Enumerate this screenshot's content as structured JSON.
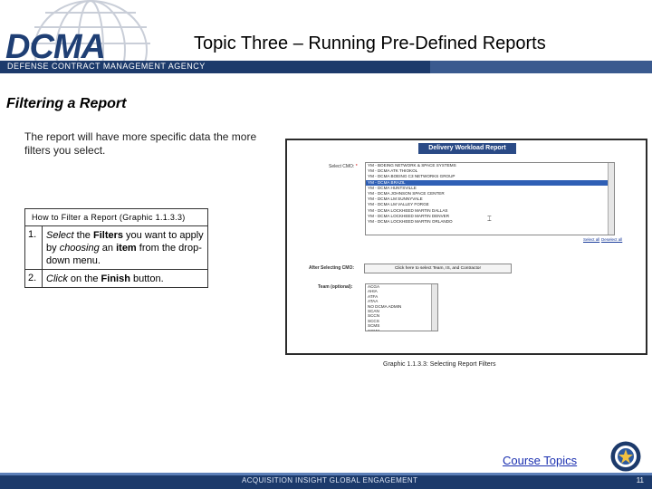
{
  "header": {
    "logo_text": "DCMA",
    "agency_name": "DEFENSE CONTRACT MANAGEMENT AGENCY",
    "title": "Topic Three – Running Pre-Defined Reports"
  },
  "section_title": "Filtering a Report",
  "intro": "The report will have more specific data the more filters you select.",
  "instructions": {
    "header": "How to Filter a Report (Graphic 1.1.3.3)",
    "steps": [
      {
        "num": "1.",
        "text": "Select the Filters you want to apply by choosing an item from the drop-down menu."
      },
      {
        "num": "2.",
        "text": "Click on the Finish button."
      }
    ]
  },
  "screenshot": {
    "title": "Delivery Workload Report",
    "select_cmo_label": "Select CMO:",
    "required_marker": "*",
    "cmo_options": [
      "YM - BOEING NETWORK & SPACE SYSTEMS",
      "YM - DCMA ATK THIOKOL",
      "YM - DCMA BOEING C3 NETWORKS GROUP",
      "YM - DCMA BRAZIL",
      "YM - DCMA HUNTSVILLE",
      "YM - DCMA JOHNSON SPACE CENTER",
      "YM - DCMA LM SUNNYVALE",
      "YM - DCMA LM VALLEY FORGE",
      "YM - DCMA LOCKHEED MARTIN DALLAS",
      "YM - DCMA LOCKHEED MARTIN DENVER",
      "YM - DCMA LOCKHEED MARTIN ORLANDO"
    ],
    "selected_index": 3,
    "select_all_link": "Select all",
    "deselect_all_link": "Deselect all",
    "after_selecting_label": "After Selecting CMO:",
    "team_button_label": "Click here to select Team, IS, and Contractor",
    "team_label": "Team (optional):",
    "team_options": [
      "ACGA",
      "AHIA",
      "ATFA",
      "ATAA",
      "NO DCMA ADMIN",
      "SCAN",
      "SCCN",
      "SCCS",
      "SCMS",
      "SCMX",
      "SCPS"
    ]
  },
  "caption": "Graphic 1.1.3.3: Selecting Report Filters",
  "course_topics_link": "Course Topics",
  "footer": {
    "tagline": "ACQUISITION INSIGHT GLOBAL ENGAGEMENT",
    "page_number": "11"
  },
  "colors": {
    "brand_navy": "#1c3a6b",
    "link_blue": "#1a2fb0",
    "selected_row": "#2f5fb5"
  }
}
